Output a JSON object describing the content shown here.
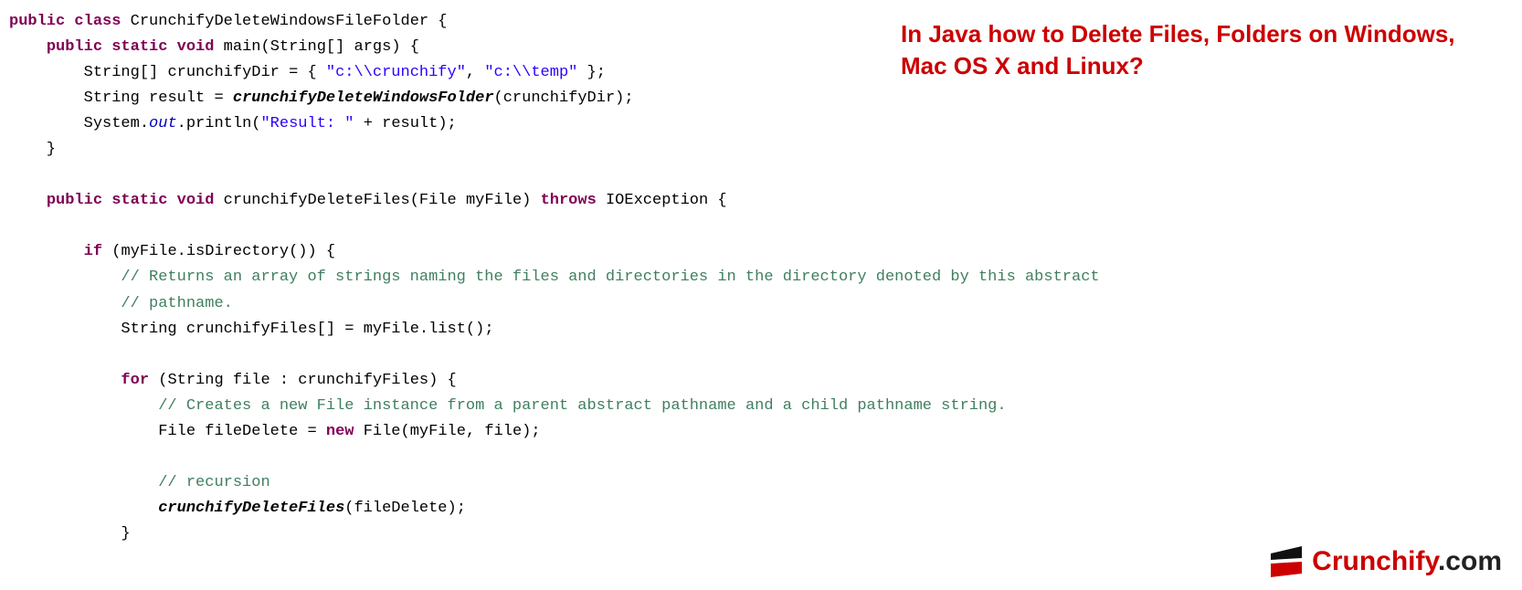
{
  "header": {
    "title": "In Java how to Delete Files, Folders on Windows, Mac OS X and Linux?"
  },
  "code": {
    "t": {
      "public": "public",
      "class": "class",
      "static": "static",
      "void": "void",
      "throws": "throws",
      "if": "if",
      "for": "for",
      "new": "new",
      "className": "CrunchifyDeleteWindowsFileFolder",
      "main": "main",
      "stringArr": "String[]",
      "args": "args",
      "crunchifyDir": "crunchifyDir",
      "s1": "\"c:\\\\crunchify\"",
      "s2": "\"c:\\\\temp\"",
      "String": "String",
      "result": "result",
      "delWinFolder": "crunchifyDeleteWindowsFolder",
      "System": "System",
      "out": "out",
      "println": "println",
      "resultLabel": "\"Result: \"",
      "delFiles": "crunchifyDeleteFiles",
      "File": "File",
      "myFile": "myFile",
      "IOException": "IOException",
      "isDirectory": "isDirectory",
      "c1a": "// Returns an array of strings naming the files and directories in the directory denoted by this abstract",
      "c1b": "// pathname.",
      "crunchifyFiles": "crunchifyFiles",
      "list": "list",
      "file": "file",
      "c2": "// Creates a new File instance from a parent abstract pathname and a child pathname string.",
      "fileDelete": "fileDelete",
      "c3": "// recursion"
    }
  },
  "logo": {
    "brand": "Crunchify",
    "suffix": ".com"
  }
}
